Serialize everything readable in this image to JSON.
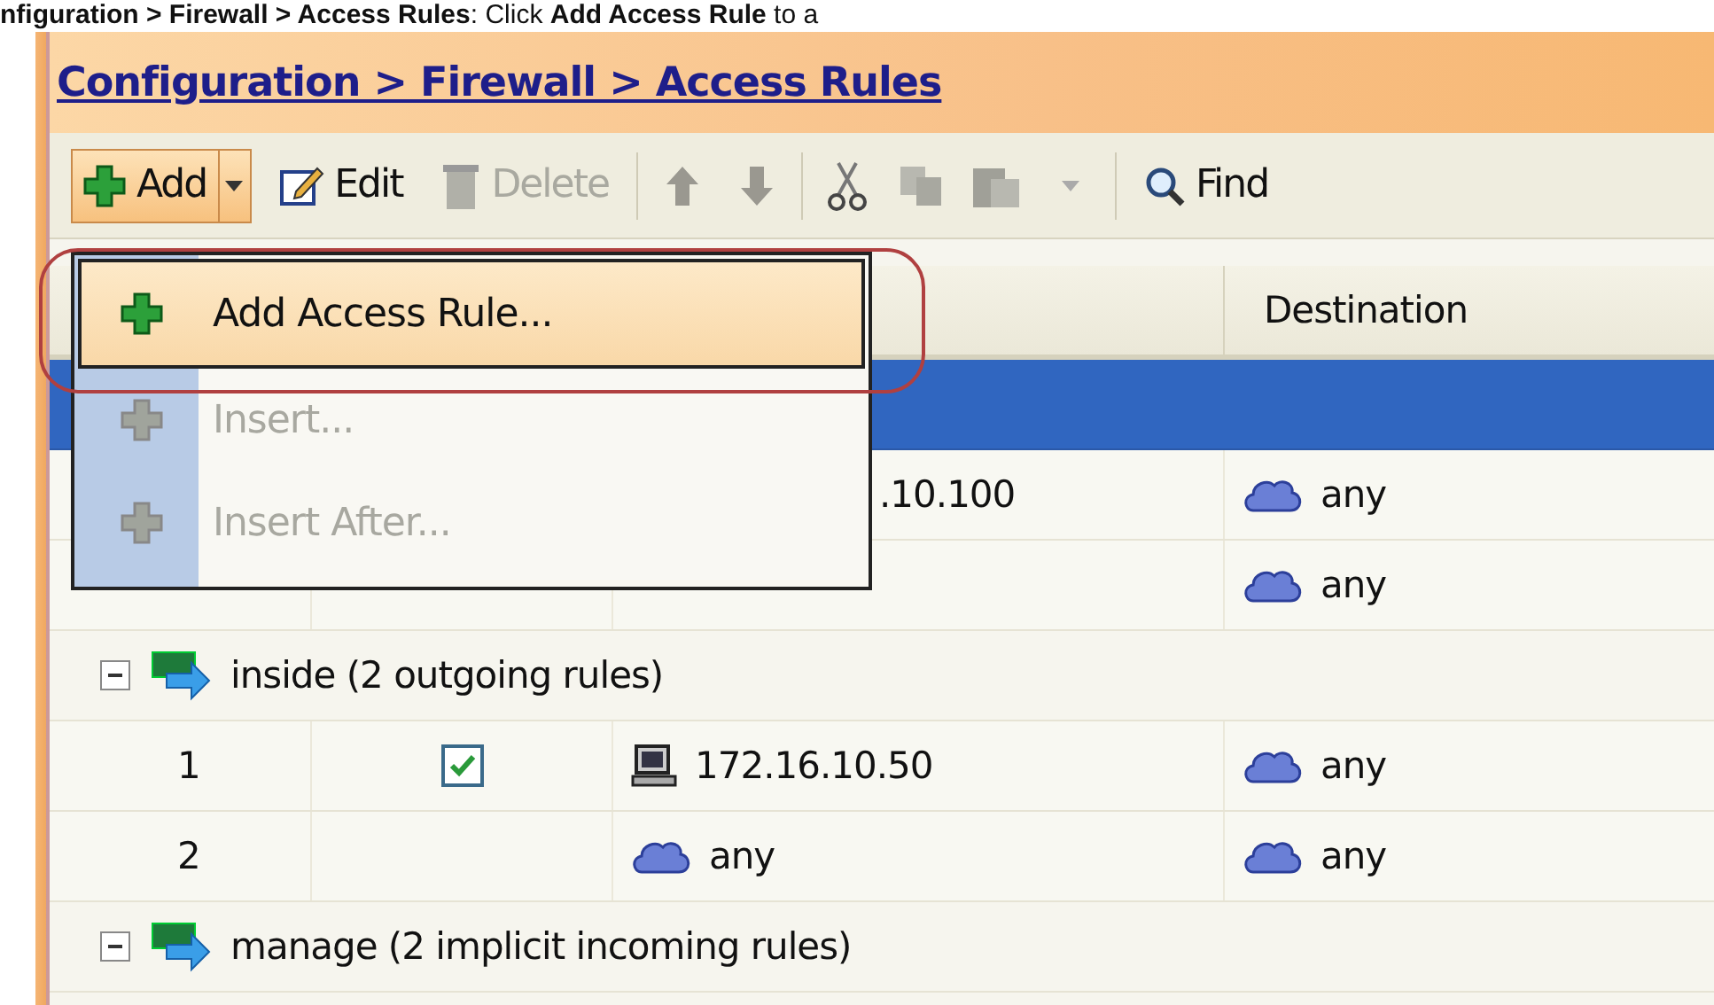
{
  "caption": "**nfiguration > Firewall > Access Rules**: Click **Add Access Rule** to a",
  "breadcrumb": "Configuration > Firewall > Access Rules",
  "toolbar": [
    {
      "label": "Add",
      "pressed": true,
      "disabled": false
    },
    {
      "label": "Edit",
      "pressed": false,
      "disabled": false
    },
    {
      "label": "Delete",
      "pressed": false,
      "disabled": true
    },
    {
      "label": "Find",
      "pressed": false,
      "disabled": false
    }
  ],
  "columns": [
    "Destination"
  ],
  "groups": [
    {
      "selected": true,
      "rules": [
        {
          "source": {
            "text": ".10.100"
          },
          "destination": {
            "kind": "network",
            "text": "any"
          }
        },
        {
          "destination": {
            "kind": "network",
            "text": "any"
          }
        }
      ]
    },
    {
      "label": "inside (2 outgoing rules)",
      "selected": false,
      "expanded": true,
      "rules": [
        {
          "number": "1",
          "enabled": true,
          "source": {
            "kind": "host",
            "text": "172.16.10.50"
          },
          "destination": {
            "kind": "network",
            "text": "any"
          }
        },
        {
          "number": "2",
          "source": {
            "kind": "network",
            "text": "any"
          },
          "destination": {
            "kind": "network",
            "text": "any"
          }
        }
      ]
    },
    {
      "label": "manage (2 implicit incoming rules)",
      "selected": false,
      "expanded": true
    }
  ],
  "menu": [
    {
      "label": "Add Access Rule...",
      "selected": true,
      "disabled": false
    },
    {
      "label": "Insert...",
      "selected": false,
      "disabled": true
    },
    {
      "label": "Insert After...",
      "selected": false,
      "disabled": true
    }
  ]
}
